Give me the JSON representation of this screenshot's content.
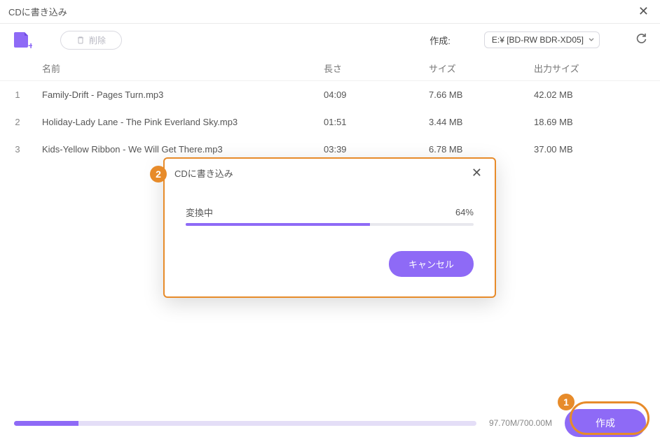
{
  "window": {
    "title": "CDに書き込み"
  },
  "toolbar": {
    "delete_label": "削除",
    "create_label": "作成:",
    "drive_value": "E:¥ [BD-RW  BDR-XD05]"
  },
  "table": {
    "headers": {
      "name": "名前",
      "length": "長さ",
      "size": "サイズ",
      "output_size": "出力サイズ"
    },
    "rows": [
      {
        "idx": "1",
        "name": "Family-Drift - Pages Turn.mp3",
        "length": "04:09",
        "size": "7.66 MB",
        "output": "42.02 MB"
      },
      {
        "idx": "2",
        "name": "Holiday-Lady Lane - The Pink Everland Sky.mp3",
        "length": "01:51",
        "size": "3.44 MB",
        "output": "18.69 MB"
      },
      {
        "idx": "3",
        "name": "Kids-Yellow Ribbon - We Will Get There.mp3",
        "length": "03:39",
        "size": "6.78 MB",
        "output": "37.00 MB"
      }
    ]
  },
  "footer": {
    "used_text": "97.70M/700.00M",
    "create_button": "作成",
    "fill_percent": 14
  },
  "dialog": {
    "title": "CDに書き込み",
    "status_label": "変換中",
    "percent_text": "64%",
    "percent_value": 64,
    "cancel_label": "キャンセル"
  },
  "annotations": {
    "one": "1",
    "two": "2"
  }
}
